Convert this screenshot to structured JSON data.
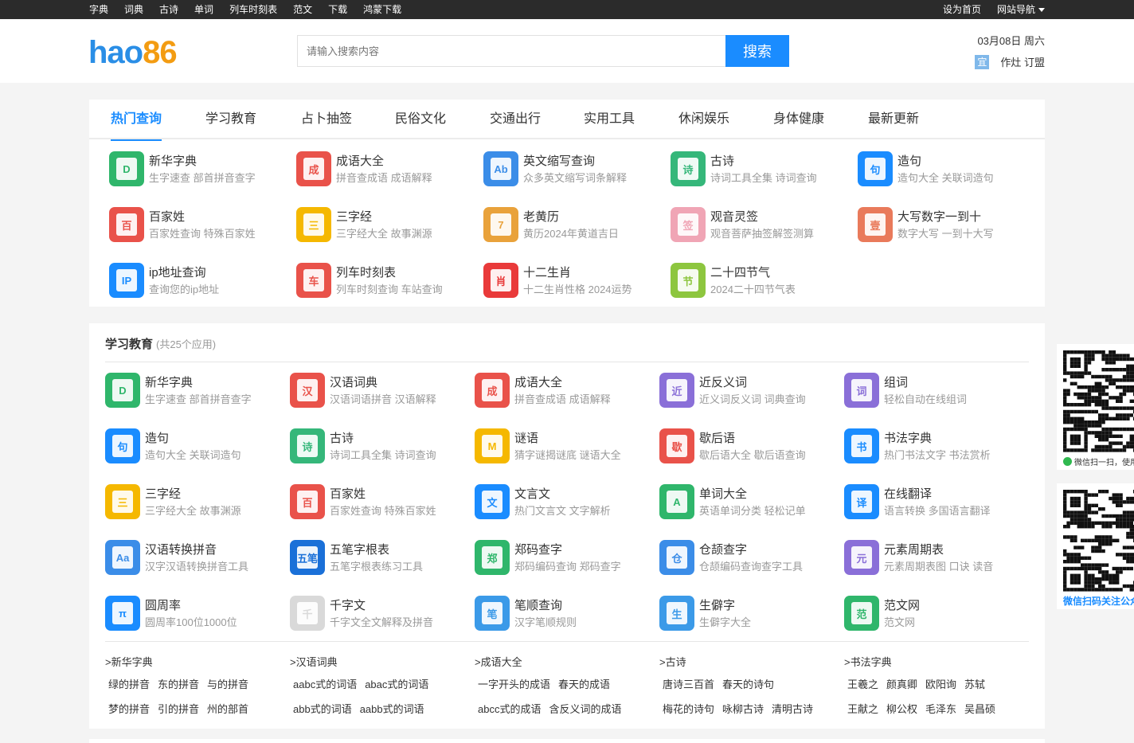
{
  "topbar": {
    "links": [
      "字典",
      "词典",
      "古诗",
      "单词",
      "列车时刻表",
      "范文",
      "下载",
      "鸿蒙下载"
    ],
    "set_home": "设为首页",
    "site_nav": "网站导航"
  },
  "logo": {
    "part1": "hao",
    "part2": "86"
  },
  "search": {
    "placeholder": "请输入搜索内容",
    "button": "搜索"
  },
  "calendar": {
    "date": "03月08日 周六",
    "yi_label": "宜",
    "yi_text": "作灶 订盟"
  },
  "tabs": [
    "热门查询",
    "学习教育",
    "占卜抽签",
    "民俗文化",
    "交通出行",
    "实用工具",
    "休闲娱乐",
    "身体健康",
    "最新更新"
  ],
  "hot_items": [
    {
      "title": "新华字典",
      "sub": "生字速查 部首拼音查字",
      "icon": "dictionary-icon",
      "color": "#2fb66b",
      "glyph": "D"
    },
    {
      "title": "成语大全",
      "sub": "拼音查成语 成语解释",
      "icon": "idiom-icon",
      "color": "#e9524a",
      "glyph": "成"
    },
    {
      "title": "英文缩写查询",
      "sub": "众多英文缩写词条解释",
      "icon": "abbreviation-icon",
      "color": "#3b8de8",
      "glyph": "Ab"
    },
    {
      "title": "古诗",
      "sub": "诗词工具全集 诗词查询",
      "icon": "poem-icon",
      "color": "#35b77a",
      "glyph": "诗"
    },
    {
      "title": "造句",
      "sub": "造句大全 关联词造句",
      "icon": "sentence-icon",
      "color": "#1a8cff",
      "glyph": "句"
    },
    {
      "title": "百家姓",
      "sub": "百家姓查询 特殊百家姓",
      "icon": "surname-icon",
      "color": "#e9524a",
      "glyph": "百"
    },
    {
      "title": "三字经",
      "sub": "三字经大全 故事渊源",
      "icon": "sanzijing-icon",
      "color": "#f5b800",
      "glyph": "三"
    },
    {
      "title": "老黄历",
      "sub": "黄历2024年黄道吉日",
      "icon": "almanac-icon",
      "color": "#e9a23b",
      "glyph": "7"
    },
    {
      "title": "观音灵签",
      "sub": "观音菩萨抽签解签测算",
      "icon": "lotus-icon",
      "color": "#f0a5b5",
      "glyph": "签"
    },
    {
      "title": "大写数字一到十",
      "sub": "数字大写 一到十大写",
      "icon": "number-convert-icon",
      "color": "#e97a5b",
      "glyph": "壹"
    },
    {
      "title": "ip地址查询",
      "sub": "查询您的ip地址",
      "icon": "ip-icon",
      "color": "#1a8cff",
      "glyph": "IP"
    },
    {
      "title": "列车时刻表",
      "sub": "列车时刻查询 车站查询",
      "icon": "train-icon",
      "color": "#e9524a",
      "glyph": "车"
    },
    {
      "title": "十二生肖",
      "sub": "十二生肖性格 2024运势",
      "icon": "zodiac-icon",
      "color": "#e93a3a",
      "glyph": "肖"
    },
    {
      "title": "二十四节气",
      "sub": "2024二十四节气表",
      "icon": "solar-term-icon",
      "color": "#8dc63f",
      "glyph": "节"
    }
  ],
  "edu": {
    "title": "学习教育",
    "count": "(共25个应用)",
    "items": [
      {
        "title": "新华字典",
        "sub": "生字速查 部首拼音查字",
        "icon": "dictionary-icon",
        "color": "#2fb66b",
        "glyph": "D"
      },
      {
        "title": "汉语词典",
        "sub": "汉语词语拼音 汉语解释",
        "icon": "chinese-dict-icon",
        "color": "#e9524a",
        "glyph": "汉"
      },
      {
        "title": "成语大全",
        "sub": "拼音查成语 成语解释",
        "icon": "idiom-icon",
        "color": "#e9524a",
        "glyph": "成"
      },
      {
        "title": "近反义词",
        "sub": "近义词反义词 词典查询",
        "icon": "synonym-icon",
        "color": "#8a6fd8",
        "glyph": "近"
      },
      {
        "title": "组词",
        "sub": "轻松自动在线组词",
        "icon": "word-group-icon",
        "color": "#8a6fd8",
        "glyph": "词"
      },
      {
        "title": "造句",
        "sub": "造句大全 关联词造句",
        "icon": "sentence-icon",
        "color": "#1a8cff",
        "glyph": "句"
      },
      {
        "title": "古诗",
        "sub": "诗词工具全集 诗词查询",
        "icon": "poem-icon",
        "color": "#35b77a",
        "glyph": "诗"
      },
      {
        "title": "谜语",
        "sub": "猜字谜揭谜底 谜语大全",
        "icon": "riddle-icon",
        "color": "#f5b800",
        "glyph": "M"
      },
      {
        "title": "歇后语",
        "sub": "歇后语大全 歇后语查询",
        "icon": "xiehouyu-icon",
        "color": "#e9524a",
        "glyph": "歇"
      },
      {
        "title": "书法字典",
        "sub": "热门书法文字 书法赏析",
        "icon": "brush-icon",
        "color": "#1a8cff",
        "glyph": "书"
      },
      {
        "title": "三字经",
        "sub": "三字经大全 故事渊源",
        "icon": "sanzijing-icon",
        "color": "#f5b800",
        "glyph": "三"
      },
      {
        "title": "百家姓",
        "sub": "百家姓查询 特殊百家姓",
        "icon": "surname-icon",
        "color": "#e9524a",
        "glyph": "百"
      },
      {
        "title": "文言文",
        "sub": "热门文言文 文字解析",
        "icon": "classical-chinese-icon",
        "color": "#1a8cff",
        "glyph": "文"
      },
      {
        "title": "单词大全",
        "sub": "英语单词分类 轻松记单",
        "icon": "word-a-icon",
        "color": "#2fb66b",
        "glyph": "A"
      },
      {
        "title": "在线翻译",
        "sub": "语言转换 多国语言翻译",
        "icon": "translate-icon",
        "color": "#1a8cff",
        "glyph": "译"
      },
      {
        "title": "汉语转换拼音",
        "sub": "汉字汉语转换拼音工具",
        "icon": "pinyin-icon",
        "color": "#3b8de8",
        "glyph": "Aa"
      },
      {
        "title": "五笔字根表",
        "sub": "五笔字根表练习工具",
        "icon": "wubi-icon",
        "color": "#1a70d8",
        "glyph": "五笔"
      },
      {
        "title": "郑码查字",
        "sub": "郑码编码查询 郑码查字",
        "icon": "zhengma-icon",
        "color": "#2fb66b",
        "glyph": "郑"
      },
      {
        "title": "仓颉查字",
        "sub": "仓颉编码查询查字工具",
        "icon": "cangjie-icon",
        "color": "#3b8de8",
        "glyph": "仓"
      },
      {
        "title": "元素周期表",
        "sub": "元素周期表图 口诀 读音",
        "icon": "periodic-table-icon",
        "color": "#8a6fd8",
        "glyph": "元"
      },
      {
        "title": "圆周率",
        "sub": "圆周率100位1000位",
        "icon": "pi-icon",
        "color": "#1a8cff",
        "glyph": "π"
      },
      {
        "title": "千字文",
        "sub": "千字文全文解释及拼音",
        "icon": "qianziwen-icon",
        "color": "#d9d9d9",
        "glyph": "千"
      },
      {
        "title": "笔顺查询",
        "sub": "汉字笔顺规则",
        "icon": "stroke-order-icon",
        "color": "#3b9ae8",
        "glyph": "笔"
      },
      {
        "title": "生僻字",
        "sub": "生僻字大全",
        "icon": "rare-char-icon",
        "color": "#3b9ae8",
        "glyph": "生"
      },
      {
        "title": "范文网",
        "sub": "范文网",
        "icon": "essay-icon",
        "color": "#2fb66b",
        "glyph": "范"
      }
    ]
  },
  "keywords": [
    {
      "head": ">新华字典",
      "rows": [
        [
          "绿的拼音",
          "东的拼音",
          "与的拼音"
        ],
        [
          "梦的拼音",
          "引的拼音",
          "州的部首"
        ]
      ]
    },
    {
      "head": ">汉语词典",
      "rows": [
        [
          "aabc式的词语",
          "abac式的词语"
        ],
        [
          "abb式的词语",
          "aabb式的词语"
        ]
      ]
    },
    {
      "head": ">成语大全",
      "rows": [
        [
          "一字开头的成语",
          "春天的成语"
        ],
        [
          "abcc式的成语",
          "含反义词的成语"
        ]
      ]
    },
    {
      "head": ">古诗",
      "rows": [
        [
          "唐诗三百首",
          "春天的诗句"
        ],
        [
          "梅花的诗句",
          "咏柳古诗",
          "清明古诗"
        ]
      ]
    },
    {
      "head": ">书法字典",
      "rows": [
        [
          "王羲之",
          "颜真卿",
          "欧阳询",
          "苏轼"
        ],
        [
          "王献之",
          "柳公权",
          "毛泽东",
          "吴昌硕"
        ]
      ]
    }
  ],
  "qr": {
    "caption1": "微信扫一扫，使用小程序",
    "caption2": "微信扫码关注公众号"
  }
}
